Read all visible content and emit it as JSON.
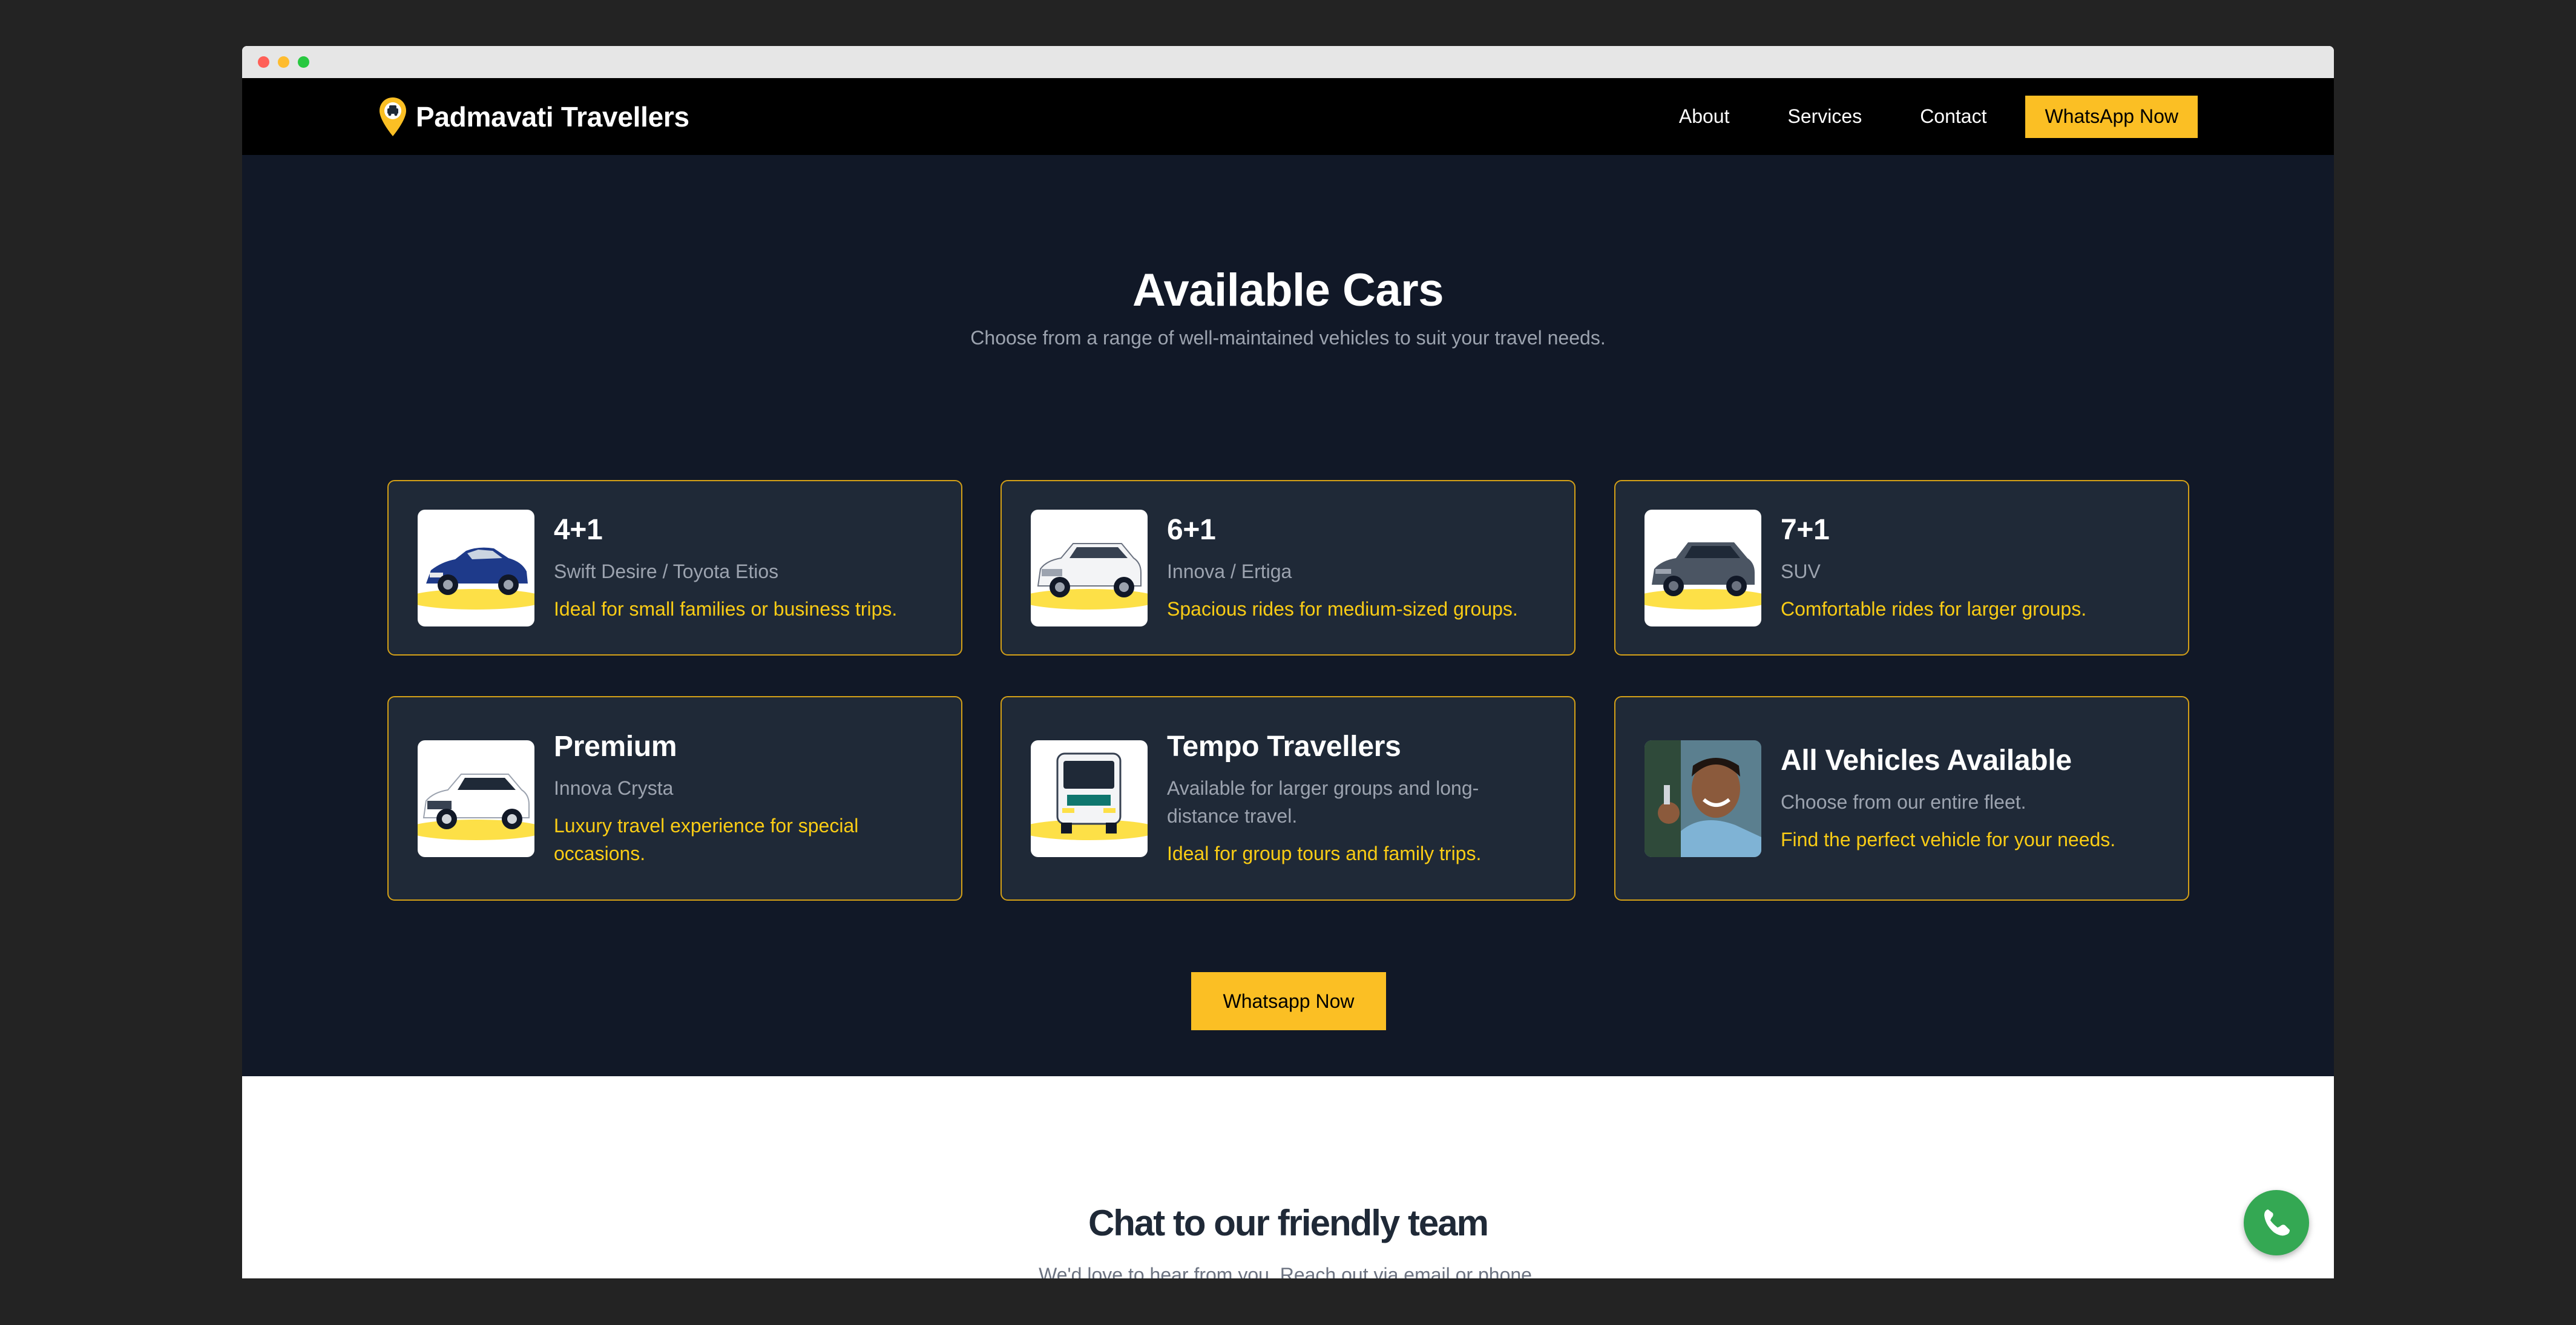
{
  "navbar": {
    "brand": "Padmavati Travellers",
    "links": [
      "About",
      "Services",
      "Contact"
    ],
    "cta": "WhatsApp Now"
  },
  "cars_section": {
    "title": "Available Cars",
    "subtitle": "Choose from a range of well-maintained vehicles to suit your travel needs.",
    "cards": [
      {
        "name": "4+1",
        "models": "Swift Desire / Toyota Etios",
        "tagline": "Ideal for small families or business trips.",
        "image": "blue-sedan"
      },
      {
        "name": "6+1",
        "models": "Innova / Ertiga",
        "tagline": "Spacious rides for medium-sized groups.",
        "image": "white-muv"
      },
      {
        "name": "7+1",
        "models": "SUV",
        "tagline": "Comfortable rides for larger groups.",
        "image": "grey-suv"
      },
      {
        "name": "Premium",
        "models": "Innova Crysta",
        "tagline": "Luxury travel experience for special occasions.",
        "image": "white-premium-muv"
      },
      {
        "name": "Tempo Travellers",
        "models": "Available for larger groups and long-distance travel.",
        "tagline": "Ideal for group tours and family trips.",
        "image": "tempo-traveller-van"
      },
      {
        "name": "All Vehicles Available",
        "models": "Choose from our entire fleet.",
        "tagline": "Find the perfect vehicle for your needs.",
        "image": "man-holding-car-keys"
      }
    ],
    "button": "Whatsapp Now"
  },
  "chat_section": {
    "title": "Chat to our friendly team",
    "subtitle": "We'd love to hear from you. Reach out via email or phone."
  },
  "colors": {
    "accent": "#fbbf24",
    "tagline": "#facc15",
    "section_bg": "#111827",
    "card_bg": "#1f2937",
    "whatsapp_green": "#34a853"
  },
  "icons": {
    "brand": "taxi-location-pin-icon",
    "floating": "whatsapp-phone-icon"
  }
}
